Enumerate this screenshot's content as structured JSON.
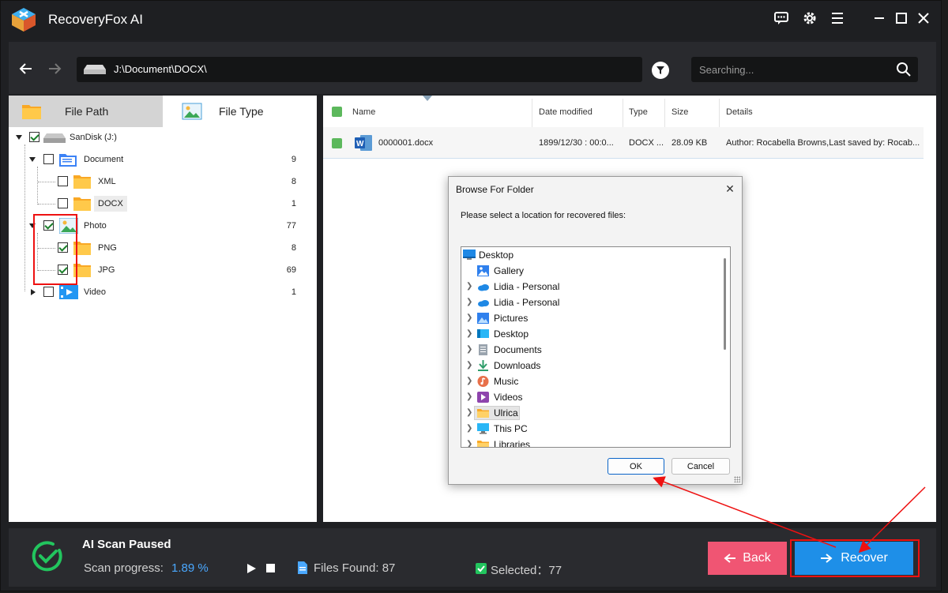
{
  "app": {
    "title": "RecoveryFox AI"
  },
  "address": {
    "path": "J:\\Document\\DOCX\\"
  },
  "search": {
    "placeholder": "Searching..."
  },
  "tabs": {
    "file_path": "File Path",
    "file_type": "File Type"
  },
  "tree": {
    "root": {
      "label": "SanDisk (J:)"
    },
    "items": [
      {
        "label": "Document",
        "count": "9"
      },
      {
        "label": "XML",
        "count": "8"
      },
      {
        "label": "DOCX",
        "count": "1"
      },
      {
        "label": "Photo",
        "count": "77"
      },
      {
        "label": "PNG",
        "count": "8"
      },
      {
        "label": "JPG",
        "count": "69"
      },
      {
        "label": "Video",
        "count": "1"
      }
    ]
  },
  "table": {
    "columns": [
      "Name",
      "Date modified",
      "Type",
      "Size",
      "Details"
    ],
    "rows": [
      {
        "name": "0000001.docx",
        "date": "1899/12/30 : 00:0...",
        "type": "DOCX ...",
        "size": "28.09 KB",
        "details": "Author: Rocabella Browns,Last saved by: Rocab..."
      }
    ]
  },
  "status": {
    "title": "AI Scan Paused",
    "progress_label": "Scan progress:",
    "progress_value": "1.89 %",
    "files_found": "Files Found: 87",
    "selected": "Selected：77"
  },
  "buttons": {
    "back": "Back",
    "recover": "Recover"
  },
  "dialog": {
    "title": "Browse For Folder",
    "message": "Please select a location for recovered files:",
    "ok": "OK",
    "cancel": "Cancel",
    "items": [
      {
        "label": "Desktop",
        "icon": "desktop-icon"
      },
      {
        "label": "Gallery",
        "icon": "gallery-icon"
      },
      {
        "label": "Lidia - Personal",
        "icon": "cloud-icon"
      },
      {
        "label": "Lidia - Personal",
        "icon": "cloud-icon"
      },
      {
        "label": "Pictures",
        "icon": "pictures-icon"
      },
      {
        "label": "Desktop",
        "icon": "desktop-icon"
      },
      {
        "label": "Documents",
        "icon": "documents-icon"
      },
      {
        "label": "Downloads",
        "icon": "downloads-icon"
      },
      {
        "label": "Music",
        "icon": "music-icon"
      },
      {
        "label": "Videos",
        "icon": "videos-icon"
      },
      {
        "label": "Ulrica",
        "icon": "folder-icon"
      },
      {
        "label": "This PC",
        "icon": "this-pc-icon"
      },
      {
        "label": "Libraries",
        "icon": "folder-icon"
      }
    ]
  },
  "colors": {
    "accent": "#1e8fe8",
    "back": "#f05573",
    "annotation": "#e11111",
    "progress": "#4aa8ff"
  }
}
